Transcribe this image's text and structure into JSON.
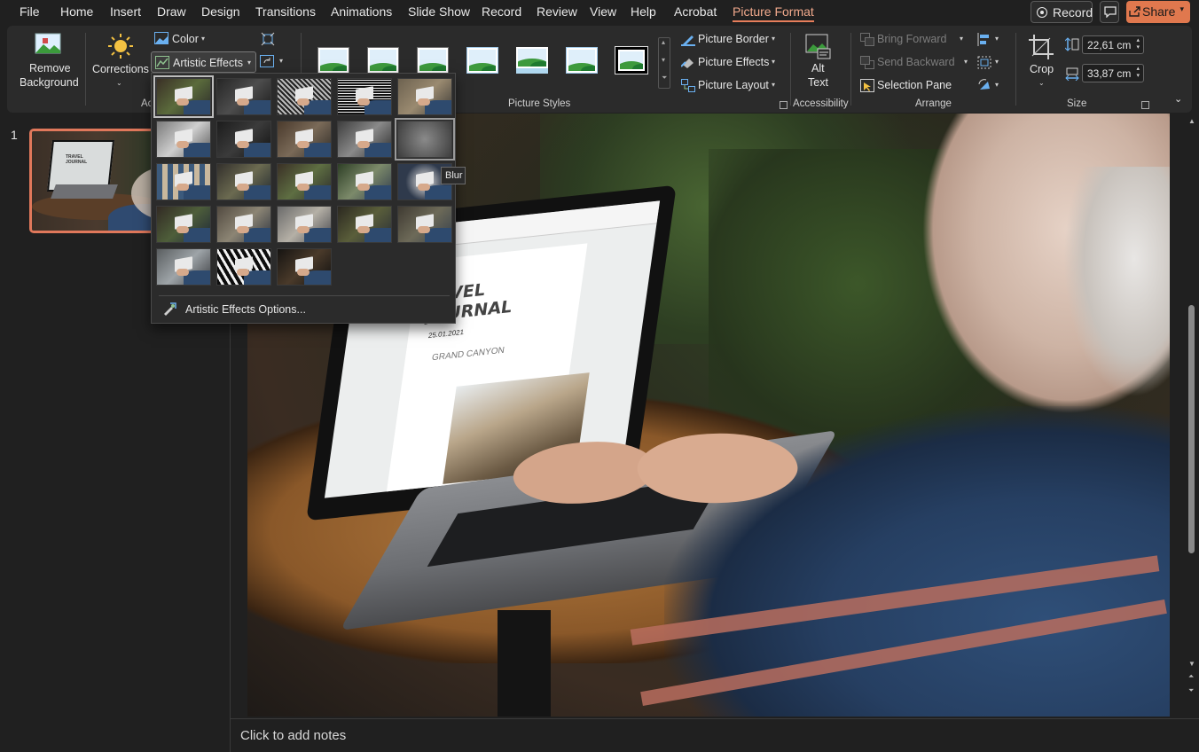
{
  "menu": {
    "tabs": [
      "File",
      "Home",
      "Insert",
      "Draw",
      "Design",
      "Transitions",
      "Animations",
      "Slide Show",
      "Record",
      "Review",
      "View",
      "Help",
      "Acrobat",
      "Picture Format"
    ],
    "active_tab": "Picture Format",
    "record_label": "Record",
    "share_label": "Share"
  },
  "ribbon": {
    "remove_background": [
      "Remove",
      "Background"
    ],
    "corrections": "Corrections",
    "color": "Color",
    "artistic_effects": "Artistic Effects",
    "adjust_group_partial": "Ac",
    "picture_styles_group": "Picture Styles",
    "picture_border": "Picture Border",
    "picture_effects": "Picture Effects",
    "picture_layout": "Picture Layout",
    "alt_text": [
      "Alt",
      "Text"
    ],
    "accessibility_group": "Accessibility",
    "bring_forward": "Bring Forward",
    "send_backward": "Send Backward",
    "selection_pane": "Selection Pane",
    "arrange_group": "Arrange",
    "crop": "Crop",
    "height": "22,61 cm",
    "width": "33,87 cm",
    "size_group": "Size"
  },
  "artistic_effects_menu": {
    "options_label": "Artistic Effects Options...",
    "tooltip": "Blur",
    "effect_count": 23
  },
  "slides": {
    "number": "1"
  },
  "notes": {
    "placeholder": "Click to add notes"
  },
  "slide_content": {
    "journal_title": [
      "VEL",
      "JOURNAL"
    ],
    "date": "25.01.2021",
    "subtitle": "GRAND CANYON",
    "thumb_title": [
      "TRAVEL",
      "JOURNAL"
    ]
  },
  "colors": {
    "accent": "#e0784e",
    "active_tab": "#f1a98c",
    "ribbon_bg": "#2b2b2b",
    "app_bg": "#202020"
  }
}
